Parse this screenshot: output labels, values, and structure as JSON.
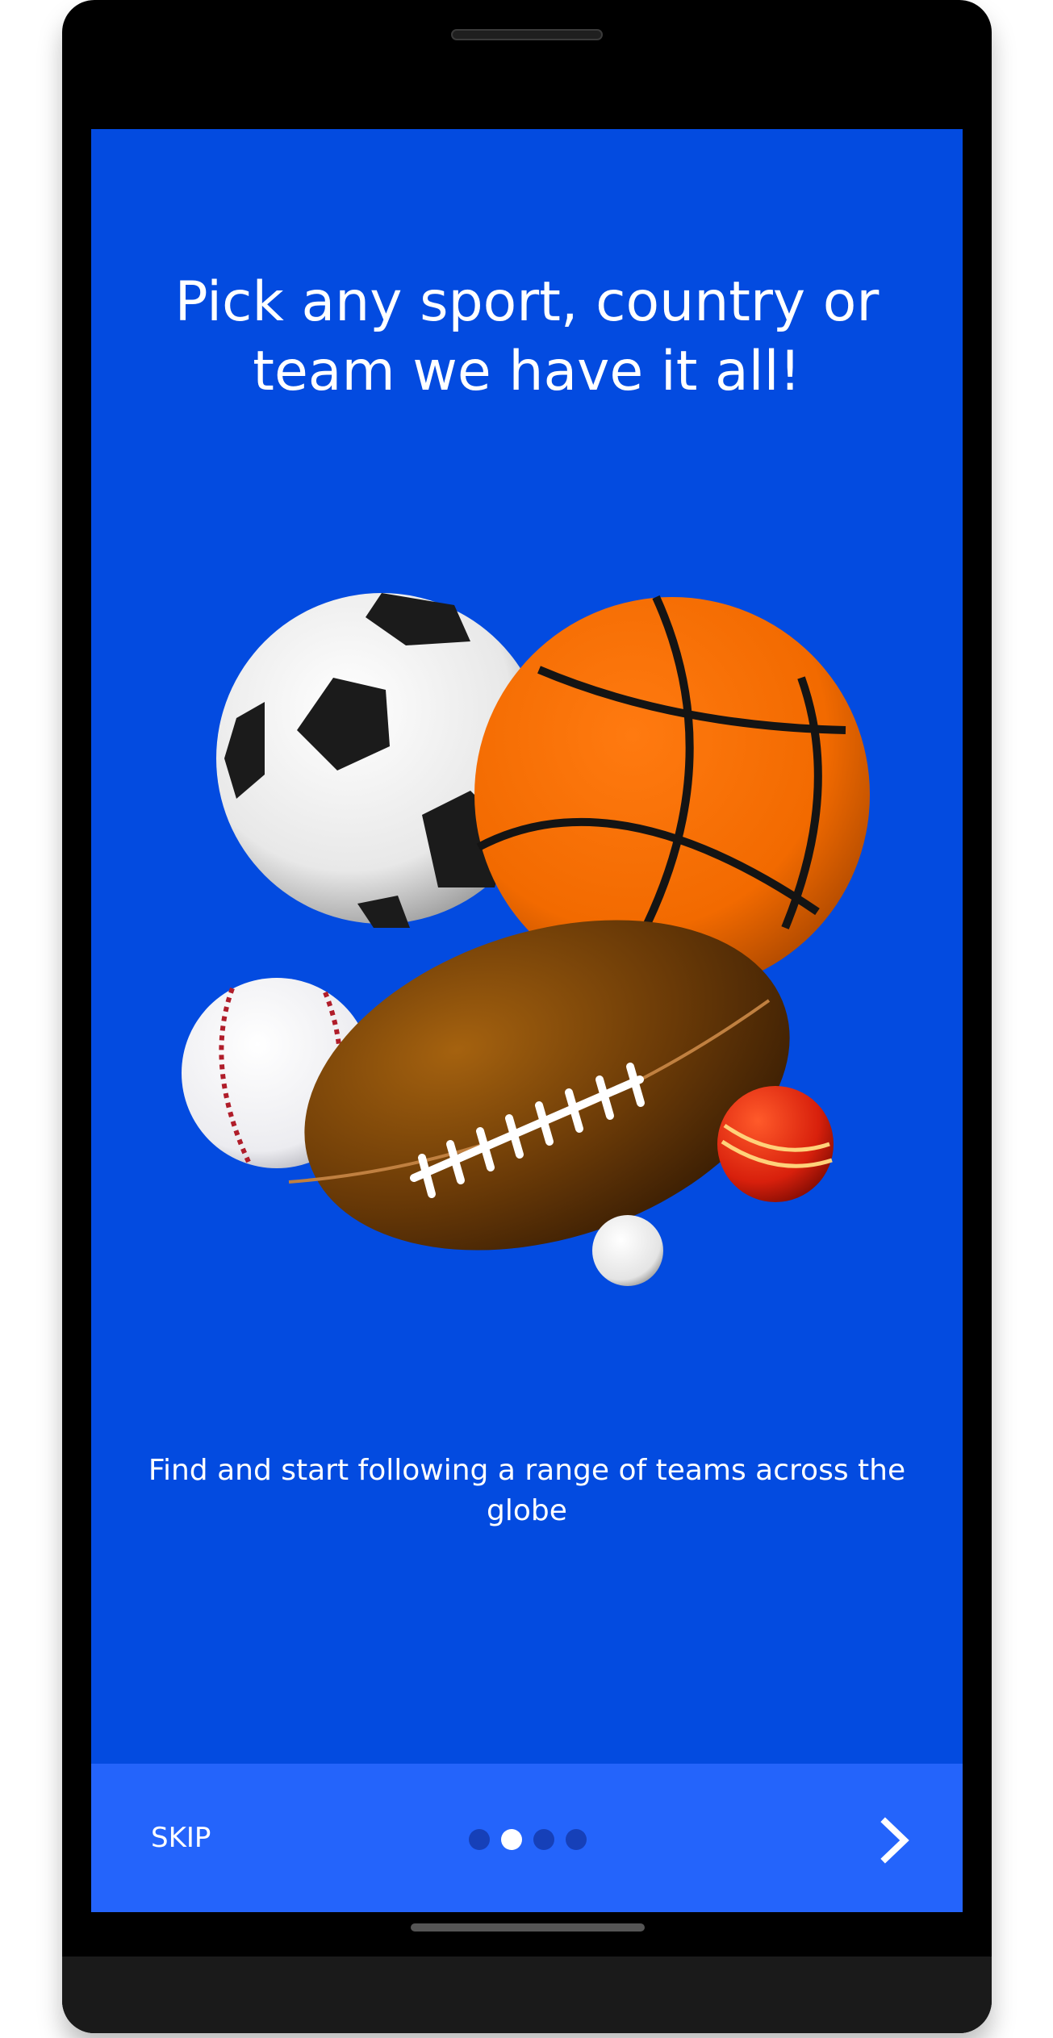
{
  "onboarding": {
    "title": "Pick any sport, country or team we have it all!",
    "subtitle": "Find and start following a range of teams across the globe",
    "illustration_icon": "sports-balls-illustration",
    "pager": {
      "page_count": 4,
      "current_page": 2
    }
  },
  "nav": {
    "skip_label": "SKIP",
    "next_icon": "chevron-right-icon"
  },
  "colors": {
    "background": "#034be0",
    "bottom_bar": "#2464fb",
    "dot_active": "#ffffff",
    "dot_inactive": "#1640b8"
  }
}
